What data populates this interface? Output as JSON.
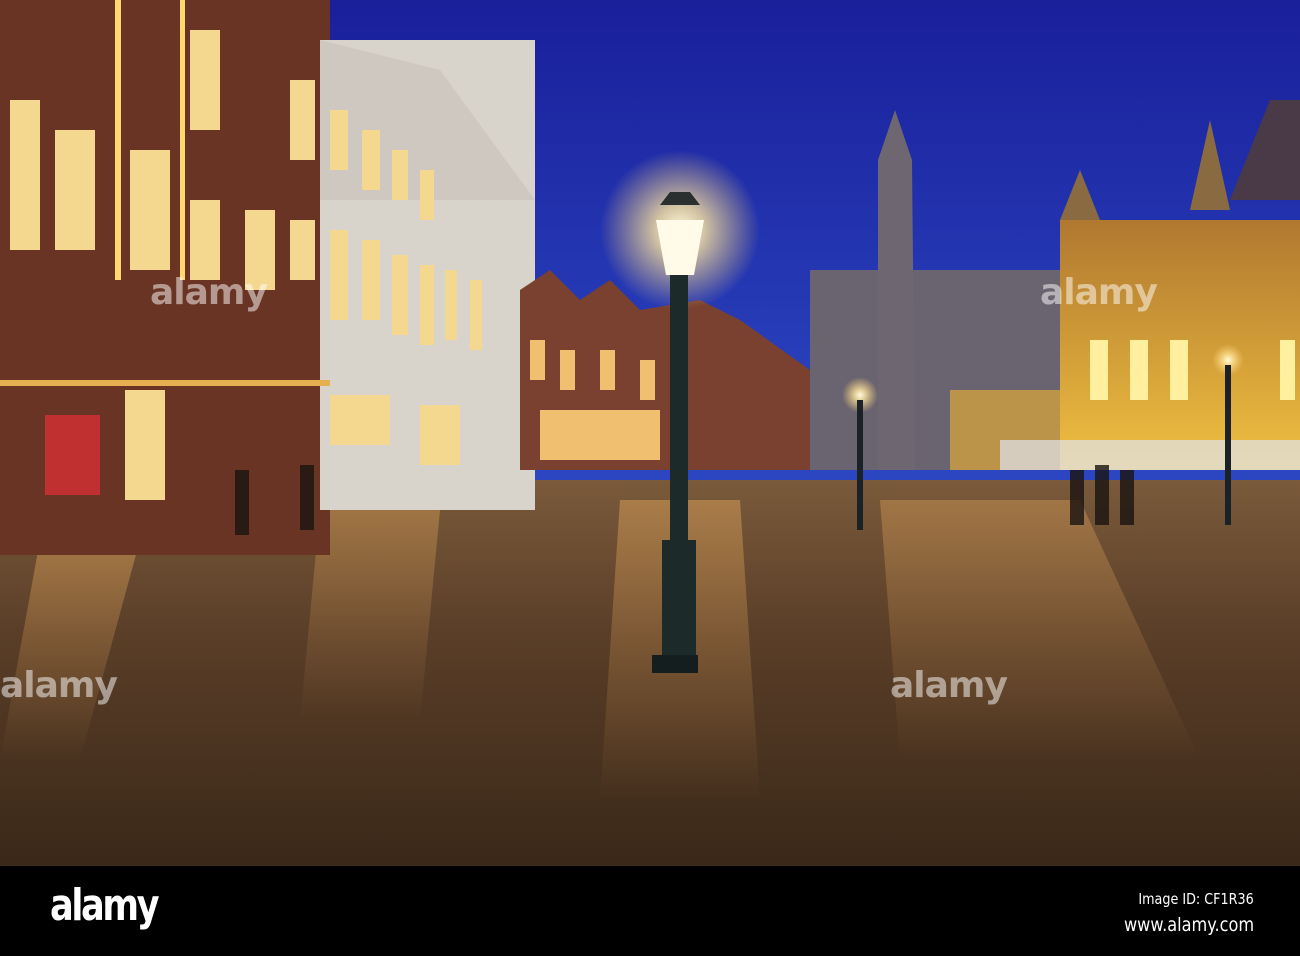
{
  "photo": {
    "subject": "Market square at dusk with lamp post and illuminated buildings",
    "colors": {
      "sky": "#1f2fa8",
      "lamp_glow": "#fff6c8",
      "facade_lit": "#e8b83a",
      "cobblestone": "#5a3a20"
    }
  },
  "watermark": {
    "text": "alamy"
  },
  "footer": {
    "logo": "alamy",
    "image_id": "Image ID: CF1R36",
    "website": "www.alamy.com"
  }
}
